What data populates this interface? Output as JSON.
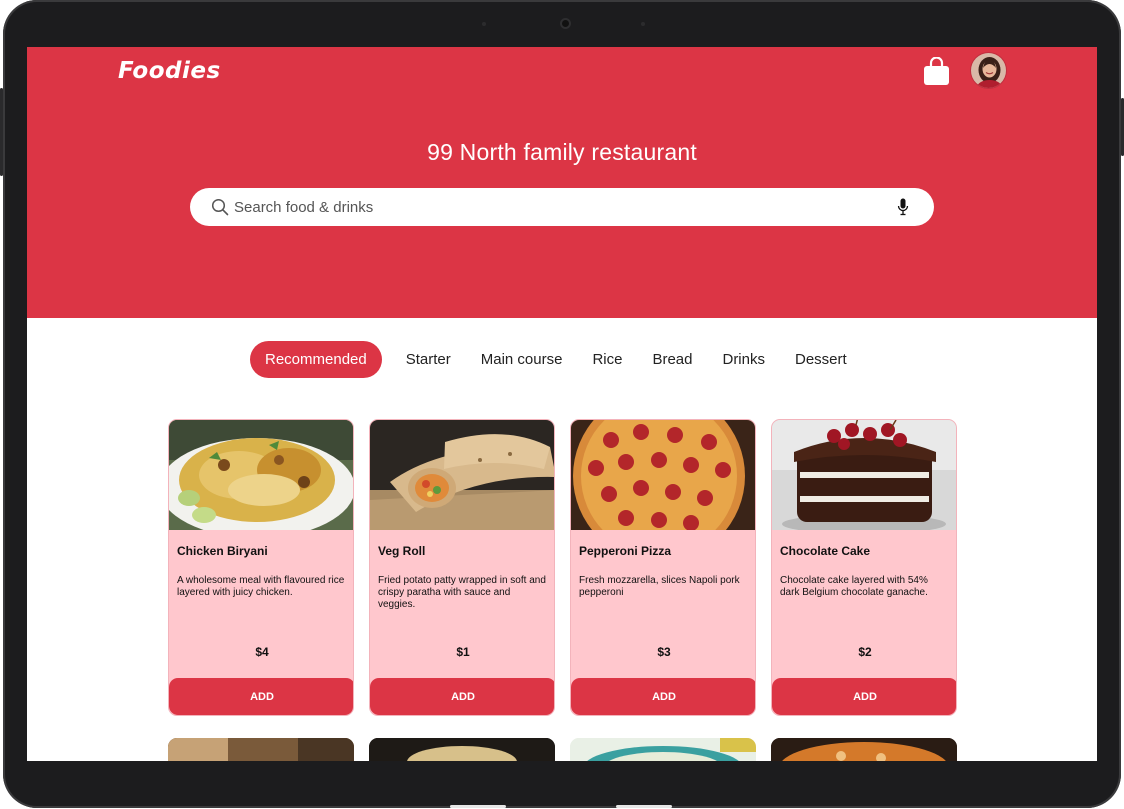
{
  "app": {
    "logo": "Foodies",
    "restaurant_name": "99 North family restaurant"
  },
  "search": {
    "placeholder": "Search food & drinks",
    "value": ""
  },
  "tabs": [
    {
      "label": "Recommended",
      "active": true
    },
    {
      "label": "Starter"
    },
    {
      "label": "Main course"
    },
    {
      "label": "Rice"
    },
    {
      "label": "Bread"
    },
    {
      "label": "Drinks"
    },
    {
      "label": "Dessert"
    }
  ],
  "cards": [
    {
      "name": "Chicken Biryani",
      "description": "A wholesome meal with flavoured rice layered with juicy chicken.",
      "price": "$4",
      "button": "ADD"
    },
    {
      "name": "Veg Roll",
      "description": "Fried potato patty wrapped in soft and crispy paratha with sauce and veggies.",
      "price": "$1",
      "button": "ADD"
    },
    {
      "name": "Pepperoni Pizza",
      "description": "Fresh mozzarella, slices Napoli pork pepperoni",
      "price": "$3",
      "button": "ADD"
    },
    {
      "name": "Chocolate Cake",
      "description": "Chocolate cake layered with 54% dark Belgium chocolate ganache.",
      "price": "$2",
      "button": "ADD"
    }
  ],
  "colors": {
    "brand": "#dc3545",
    "card_bg": "#ffc7cd",
    "device_frame": "#1c1c1e"
  },
  "icons": [
    "shopping-bag-icon",
    "search-icon",
    "microphone-icon"
  ]
}
